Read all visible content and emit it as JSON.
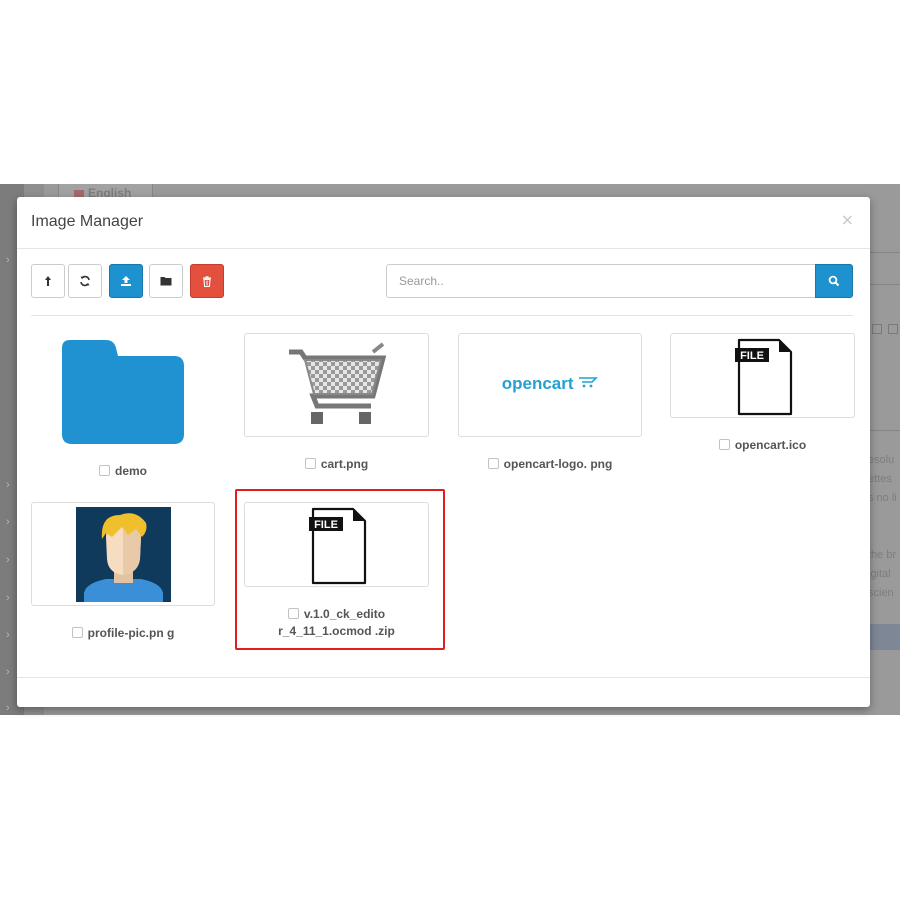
{
  "backdrop": {
    "tab_label": "English",
    "side_text": [
      "esolu",
      "ettes",
      "s no li",
      "the br",
      "igital",
      "scien"
    ]
  },
  "modal": {
    "title": "Image Manager",
    "close": "×"
  },
  "toolbar": {
    "buttons": [
      {
        "name": "parent",
        "icon": "level-up-icon",
        "glyph": "↥"
      },
      {
        "name": "refresh",
        "icon": "refresh-icon",
        "glyph": "⟳"
      },
      {
        "name": "upload",
        "icon": "upload-icon",
        "glyph": "⇪"
      },
      {
        "name": "folder",
        "icon": "folder-icon",
        "glyph": ""
      },
      {
        "name": "delete",
        "icon": "trash-icon",
        "glyph": ""
      }
    ]
  },
  "search": {
    "placeholder": "Search..",
    "button_icon": "search-icon"
  },
  "items": [
    {
      "type": "folder",
      "label": "demo"
    },
    {
      "type": "image",
      "label": "cart.png",
      "icon": "cart-icon"
    },
    {
      "type": "image",
      "label": "opencart-logo. png",
      "logo_text": "opencart"
    },
    {
      "type": "file",
      "label": "opencart.ico",
      "badge": "FILE"
    },
    {
      "type": "image",
      "label": "profile-pic.pn g",
      "icon": "avatar"
    },
    {
      "type": "file",
      "label_line1": "v.1.0_ck_edito",
      "label_line2": "r_4_11_1.ocmod .zip",
      "badge": "FILE",
      "highlighted": true
    }
  ],
  "colors": {
    "primary": "#1e91cf",
    "danger": "#e3503e",
    "highlight": "#e01e1e",
    "folder": "#2192d1",
    "logo": "#23a1d1"
  }
}
